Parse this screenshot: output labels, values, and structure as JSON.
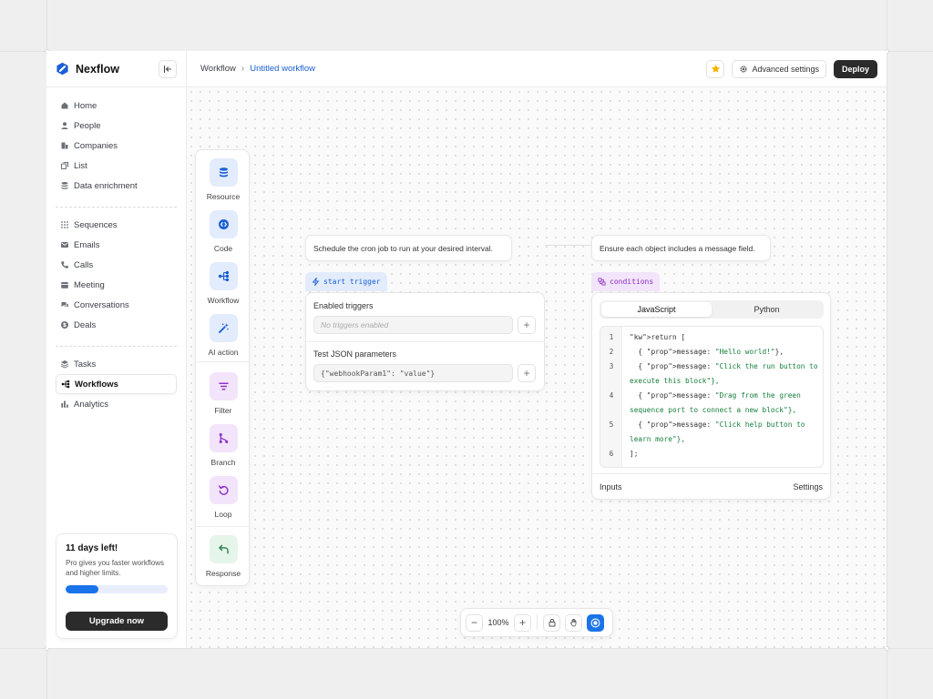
{
  "brand": {
    "name": "Nexflow"
  },
  "sidebar": {
    "groups": [
      [
        {
          "label": "Home",
          "icon": "home-icon"
        },
        {
          "label": "People",
          "icon": "user-icon"
        },
        {
          "label": "Companies",
          "icon": "building-icon"
        },
        {
          "label": "List",
          "icon": "list-icon"
        },
        {
          "label": "Data enrichment",
          "icon": "database-icon"
        }
      ],
      [
        {
          "label": "Sequences",
          "icon": "grid-dots-icon"
        },
        {
          "label": "Emails",
          "icon": "mail-icon"
        },
        {
          "label": "Calls",
          "icon": "phone-icon"
        },
        {
          "label": "Meeting",
          "icon": "calendar-icon"
        },
        {
          "label": "Conversations",
          "icon": "chat-icon"
        },
        {
          "label": "Deals",
          "icon": "dollar-icon"
        }
      ],
      [
        {
          "label": "Tasks",
          "icon": "layers-icon"
        },
        {
          "label": "Workflows",
          "icon": "workflow-icon",
          "active": true
        },
        {
          "label": "Analytics",
          "icon": "bar-chart-icon"
        }
      ]
    ]
  },
  "upgrade": {
    "title": "11 days left!",
    "text": "Pro gives you faster workflows and higher limits.",
    "progress_percent": 32,
    "button_label": "Upgrade now"
  },
  "topbar": {
    "breadcrumb_root": "Workflow",
    "breadcrumb_current": "Untitled workflow",
    "advanced_label": "Advanced settings",
    "deploy_label": "Deploy"
  },
  "palette": {
    "items": [
      {
        "label": "Resource",
        "icon": "database-icon"
      },
      {
        "label": "Code",
        "icon": "code-icon"
      },
      {
        "label": "Workflow",
        "icon": "workflow-icon"
      },
      {
        "label": "AI action",
        "icon": "magic-wand-icon"
      },
      {
        "label": "Filter",
        "icon": "filter-icon"
      },
      {
        "label": "Branch",
        "icon": "branch-icon"
      },
      {
        "label": "Loop",
        "icon": "loop-icon"
      },
      {
        "label": "Response",
        "icon": "reply-icon"
      }
    ]
  },
  "trigger_node": {
    "note": "Schedule the cron job to run at your desired interval.",
    "tag": "start trigger",
    "enabled_label": "Enabled triggers",
    "enabled_placeholder": "No triggers enabled",
    "json_label": "Test JSON parameters",
    "json_value": "{\"webhookParam1\": \"value\"}"
  },
  "conditions_node": {
    "note": "Ensure each object includes a message field.",
    "tag": "conditions",
    "tabs": [
      "JavaScript",
      "Python"
    ],
    "active_tab": "JavaScript",
    "code_line_numbers": [
      "1",
      "2",
      "3",
      "",
      "4",
      "",
      "5",
      "",
      "6"
    ],
    "code": [
      "return [",
      "  { message: \"Hello world!\"},",
      "  { message: \"Click the run button to",
      "execute this block\"},",
      "  { message: \"Drag from the green",
      "sequence port to connect a new block\"},",
      "  { message: \"Click help button to",
      "learn more\"},",
      "];"
    ],
    "footer_left": "Inputs",
    "footer_right": "Settings"
  },
  "zoom": {
    "value": "100%"
  },
  "colors": {
    "accent": "#1a73e8",
    "dark_button": "#2b2b2b",
    "tag_blue_bg": "#e3ecfc",
    "tag_purple_bg": "#f2e4fa",
    "star": "#f5b400"
  }
}
